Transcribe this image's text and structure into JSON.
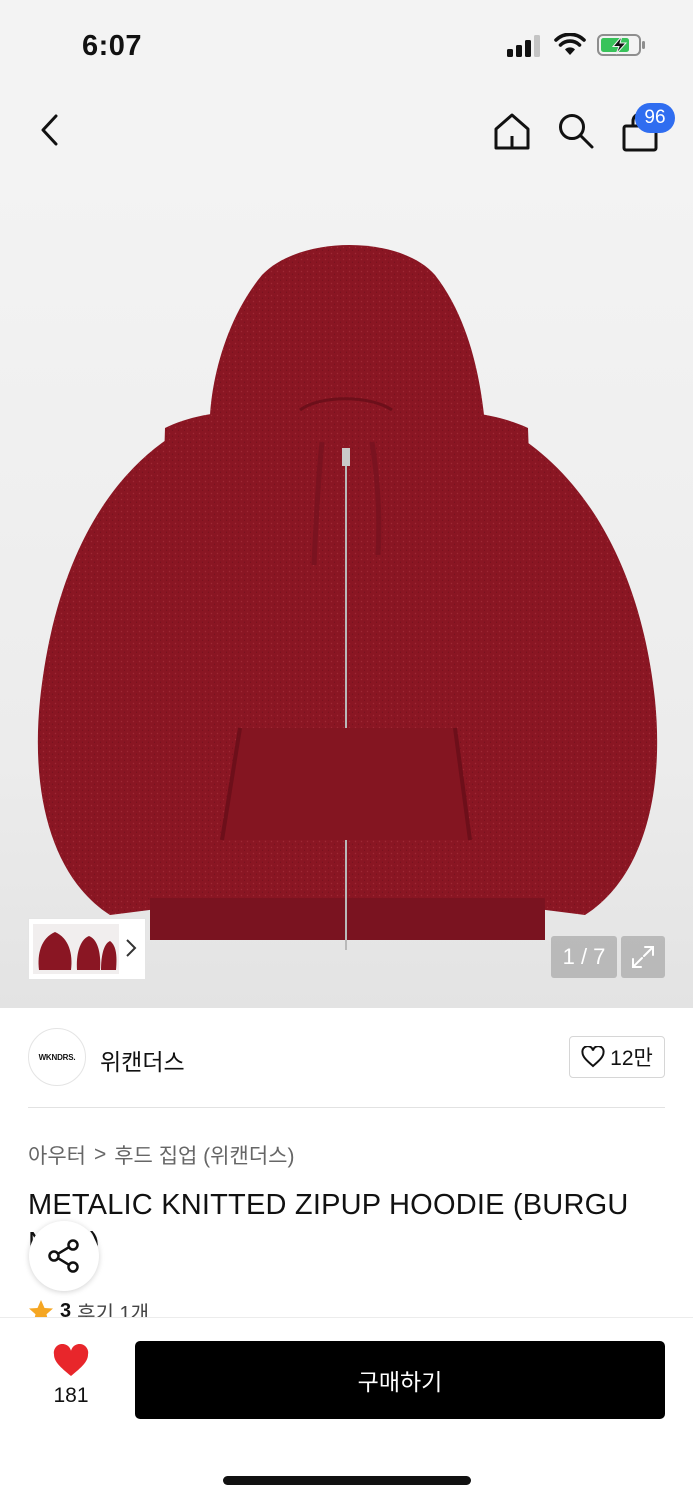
{
  "status_bar": {
    "time": "6:07",
    "icons": [
      "cellular-signal-icon",
      "wifi-icon",
      "battery-charging-icon"
    ]
  },
  "nav": {
    "icons": [
      "back-arrow-icon",
      "home-icon",
      "search-icon",
      "shopping-bag-icon"
    ],
    "cart_badge": "96"
  },
  "gallery": {
    "page_indicator": "1 / 7",
    "product_color": "#8a1623"
  },
  "brand": {
    "logo_text": "WKNDRS.",
    "name": "위캔더스",
    "likes": "12만"
  },
  "breadcrumb": {
    "category": "아우터",
    "separator": ">",
    "subcategory": "후드 집업 (위캔더스)"
  },
  "product": {
    "title": "METALIC KNITTED ZIPUP HOODIE (BURGU NDY)",
    "rating": "3",
    "reviews": "후기 1개"
  },
  "bottom_bar": {
    "wish_count": "181",
    "buy_label": "구매하기",
    "accent": "#e8262b"
  }
}
